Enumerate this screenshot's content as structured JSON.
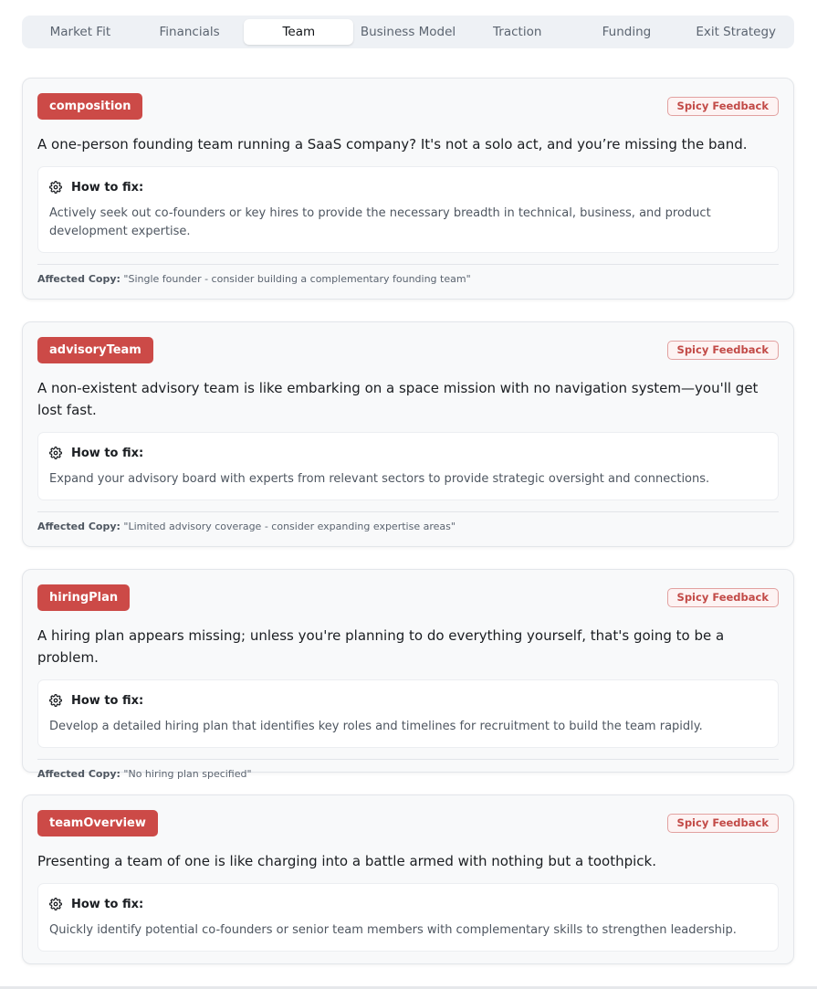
{
  "tabs": [
    {
      "label": "Market Fit",
      "active": false
    },
    {
      "label": "Financials",
      "active": false
    },
    {
      "label": "Team",
      "active": true
    },
    {
      "label": "Business Model",
      "active": false
    },
    {
      "label": "Traction",
      "active": false
    },
    {
      "label": "Funding",
      "active": false
    },
    {
      "label": "Exit Strategy",
      "active": false
    }
  ],
  "colors": {
    "category_bg": "#cc4a47",
    "badge_text": "#c24a47",
    "tab_bar_bg": "#eef1f5"
  },
  "fix_icon": "gear-icon",
  "fix_label": "How to fix:",
  "badge_label": "Spicy Feedback",
  "affected_label": "Affected Copy:",
  "cards": [
    {
      "category": "composition",
      "critique": "A one-person founding team running a SaaS company? It's not a solo act, and you’re missing the band.",
      "fix": "Actively seek out co-founders or key hires to provide the necessary breadth in technical, business, and product development expertise.",
      "affected": "\"Single founder - consider building a complementary founding team\""
    },
    {
      "category": "advisoryTeam",
      "critique": "A non-existent advisory team is like embarking on a space mission with no navigation system—you'll get lost fast.",
      "fix": "Expand your advisory board with experts from relevant sectors to provide strategic oversight and connections.",
      "affected": "\"Limited advisory coverage - consider expanding expertise areas\""
    },
    {
      "category": "hiringPlan",
      "critique": "A hiring plan appears missing; unless you're planning to do everything yourself, that's going to be a problem.",
      "fix": "Develop a detailed hiring plan that identifies key roles and timelines for recruitment to build the team rapidly.",
      "affected": "\"No hiring plan specified\""
    },
    {
      "category": "teamOverview",
      "critique": "Presenting a team of one is like charging into a battle armed with nothing but a toothpick.",
      "fix": "Quickly identify potential co-founders or senior team members with complementary skills to strengthen leadership."
    }
  ]
}
